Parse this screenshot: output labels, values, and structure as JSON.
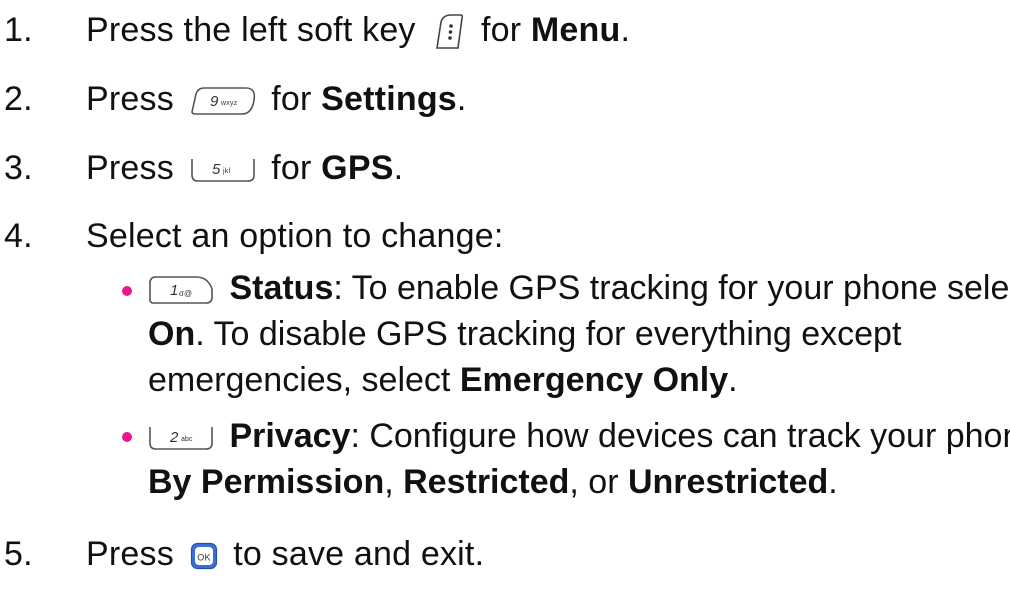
{
  "steps": [
    {
      "num": "1.",
      "pre": "Press the left soft key",
      "key_icon": "menu-soft-key-icon",
      "mid": "for",
      "bold": "Menu",
      "post": "."
    },
    {
      "num": "2.",
      "pre": "Press",
      "key_label": "9",
      "key_sub": "wxyz",
      "mid": "for",
      "bold": "Settings",
      "post": "."
    },
    {
      "num": "3.",
      "pre": "Press",
      "key_label": "5",
      "key_sub": "jkl",
      "mid": "for",
      "bold": "GPS",
      "post": "."
    },
    {
      "num": "4.",
      "text": "Select an option to change:"
    },
    {
      "num": "5.",
      "pre": "Press",
      "key_label": "OK",
      "post": "to save and exit."
    }
  ],
  "options": [
    {
      "key_label": "1",
      "key_sub": "σ@",
      "name": "Status",
      "line1_rest": ": To enable GPS tracking for your phone select",
      "line2_bold": "On",
      "line2_rest": ". To disable GPS tracking for everything except",
      "line3_pre": "emergencies, select",
      "line3_bold": "Emergency Only",
      "line3_post": "."
    },
    {
      "key_label": "2",
      "key_sub": "abc",
      "name": "Privacy",
      "line1_rest": ": Configure how devices can track your phone,",
      "line2_bold_a": "By Permission",
      "line2_sep_a": ",",
      "line2_bold_b": "Restricted",
      "line2_sep_b": ", or",
      "line2_bold_c": "Unrestricted",
      "line2_post": "."
    }
  ],
  "colors": {
    "bullet": "#e61a8d",
    "ok_key": "#3a6fd8"
  }
}
